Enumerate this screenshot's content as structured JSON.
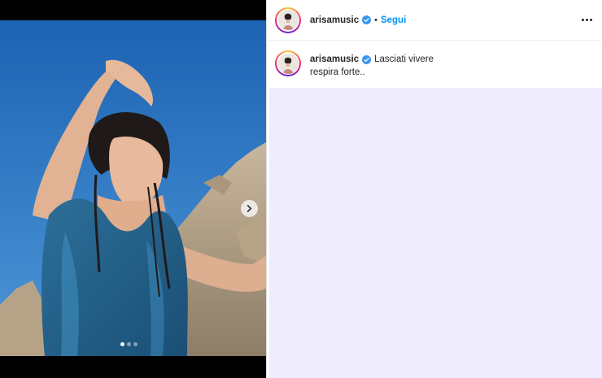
{
  "post": {
    "username": "arisamusic",
    "follow_label": "Segui",
    "separator": "•",
    "caption_line1": "Lasciati vivere",
    "caption_line2": "respira forte..",
    "media": {
      "carousel_count": 3,
      "active_index": 0
    }
  },
  "icons": {
    "verified": "verified-badge-icon",
    "more": "more-options-icon",
    "next": "chevron-right-icon"
  },
  "colors": {
    "follow": "#0095f6",
    "verified": "#3897f0",
    "comments_bg": "#efecfd"
  }
}
